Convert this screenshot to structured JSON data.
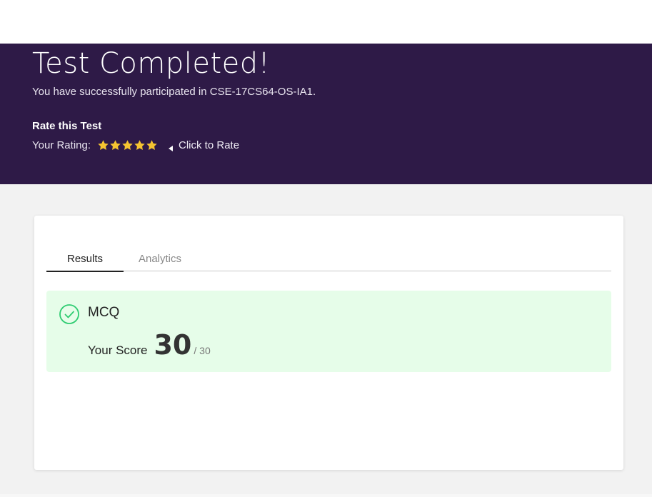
{
  "hero": {
    "title": "Test Completed!",
    "subtitle": "You have successfully participated in CSE-17CS64-OS-IA1.",
    "rate_heading": "Rate this Test",
    "rating_label": "Your Rating:",
    "rating_value": 5,
    "rating_max": 5,
    "click_to_rate": "Click to Rate",
    "background_color": "#2e1a47",
    "star_color": "#f5c431"
  },
  "tabs": [
    {
      "label": "Results",
      "active": true
    },
    {
      "label": "Analytics",
      "active": false
    }
  ],
  "result": {
    "section_name": "MCQ",
    "score_label": "Your Score",
    "score": "30",
    "total": "/ 30",
    "panel_color": "#e6fde9",
    "check_color": "#2ecc71"
  }
}
